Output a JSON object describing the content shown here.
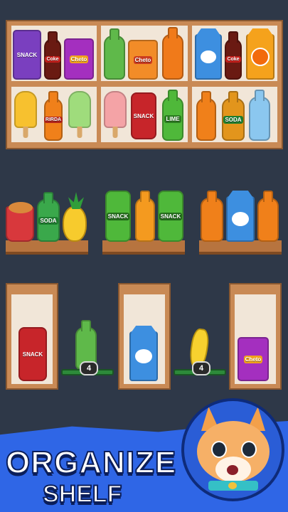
{
  "labels": {
    "snack": "SNACK",
    "coke": "Coke",
    "cheto": "Cheto",
    "soda": "SODA",
    "lime": "LIME",
    "mirinda": "RIRDA"
  },
  "counters": {
    "left_badge": "4",
    "right_badge": "4"
  },
  "banner": {
    "title_line1": "ORGANIZE",
    "title_line2": "SHELF"
  },
  "colors": {
    "background": "#2e3848",
    "wood": "#c98a55",
    "banner": "#2f66e6"
  }
}
